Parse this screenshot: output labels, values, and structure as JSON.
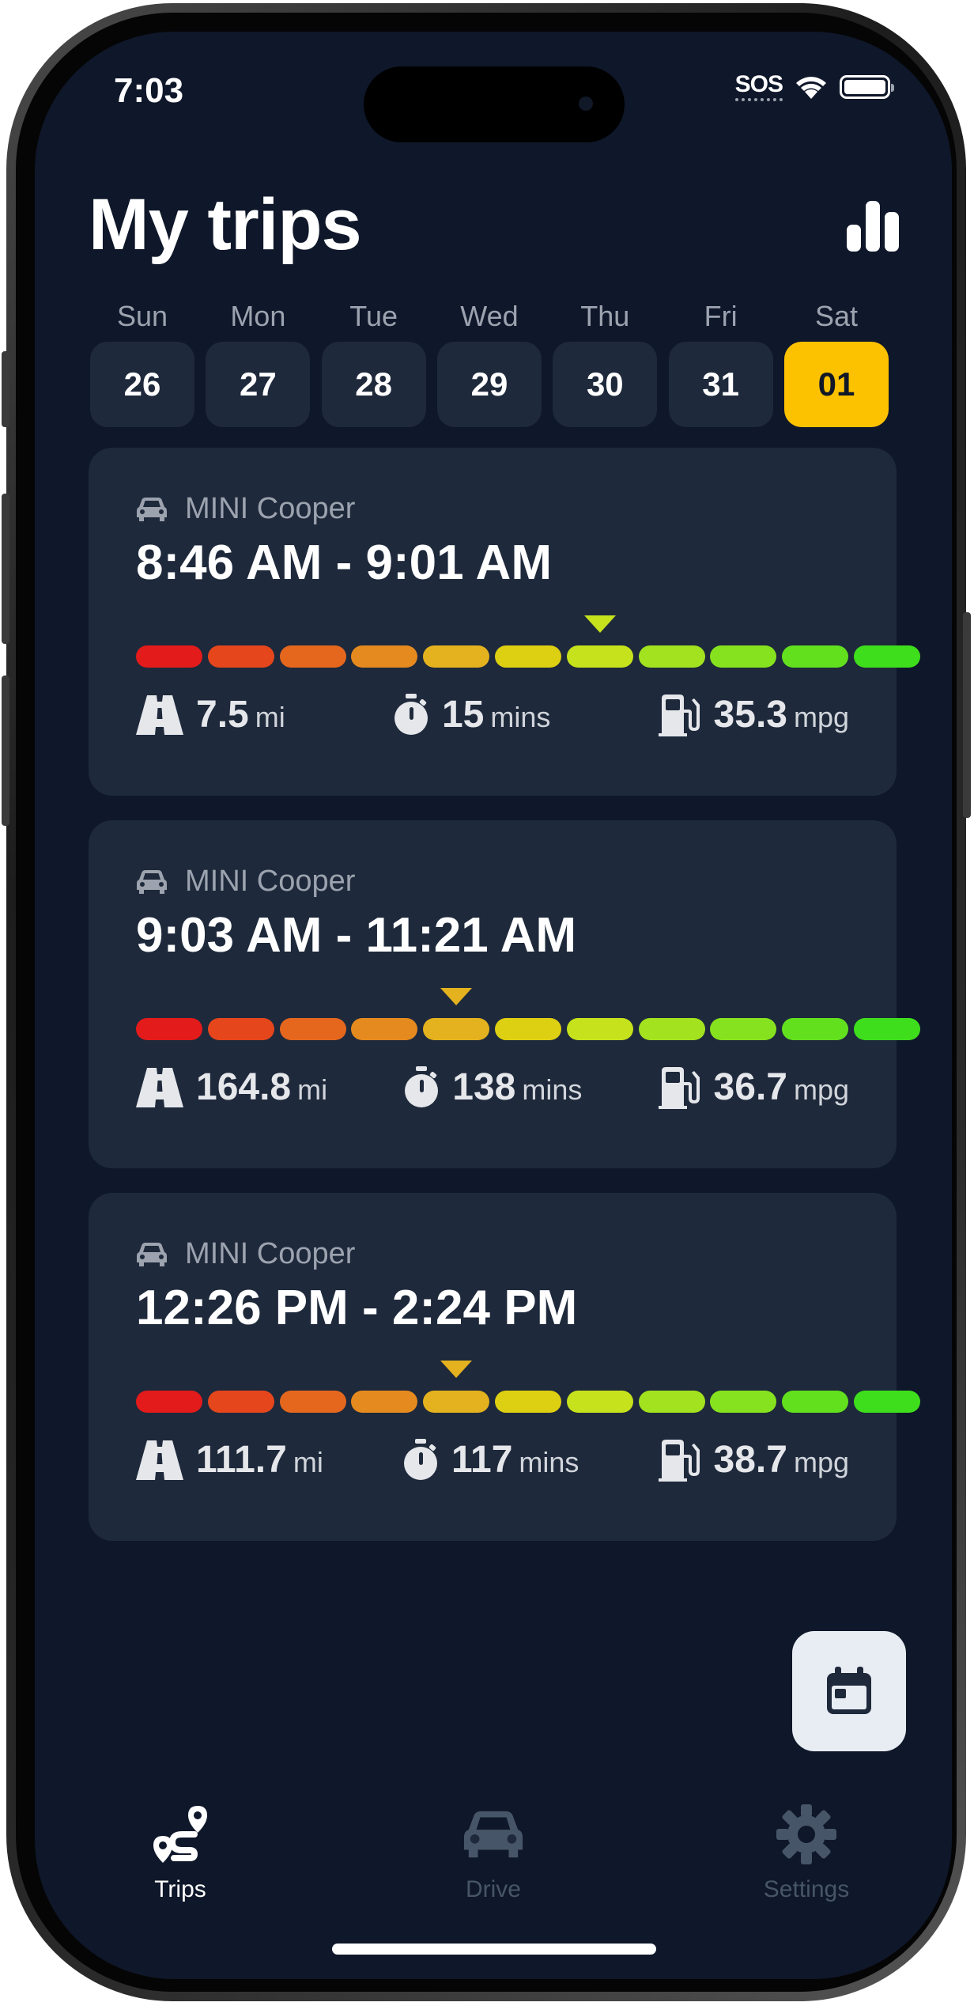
{
  "status_bar": {
    "time": "7:03",
    "carrier": "SOS"
  },
  "header": {
    "title": "My trips",
    "stats_icon": "bar-chart-icon"
  },
  "days": [
    {
      "name": "Sun",
      "date": "26",
      "selected": false
    },
    {
      "name": "Mon",
      "date": "27",
      "selected": false
    },
    {
      "name": "Tue",
      "date": "28",
      "selected": false
    },
    {
      "name": "Wed",
      "date": "29",
      "selected": false
    },
    {
      "name": "Thu",
      "date": "30",
      "selected": false
    },
    {
      "name": "Fri",
      "date": "31",
      "selected": false
    },
    {
      "name": "Sat",
      "date": "01",
      "selected": true
    }
  ],
  "efficiency_scale": {
    "segments": 11,
    "colors": [
      "#e31b1b",
      "#e5461c",
      "#e5671e",
      "#e58a1f",
      "#e3b21e",
      "#ddcf12",
      "#c6e21c",
      "#a2e21f",
      "#86e21e",
      "#62e01e",
      "#3fde1c"
    ]
  },
  "trips": [
    {
      "car": "MINI Cooper",
      "time_range": "8:46 AM - 9:01 AM",
      "efficiency_segment": 7,
      "distance": "7.5",
      "distance_unit": "mi",
      "duration": "15",
      "duration_unit": "mins",
      "economy": "35.3",
      "economy_unit": "mpg"
    },
    {
      "car": "MINI Cooper",
      "time_range": "9:03 AM - 11:21 AM",
      "efficiency_segment": 5,
      "distance": "164.8",
      "distance_unit": "mi",
      "duration": "138",
      "duration_unit": "mins",
      "economy": "36.7",
      "economy_unit": "mpg"
    },
    {
      "car": "MINI Cooper",
      "time_range": "12:26 PM - 2:24 PM",
      "efficiency_segment": 5,
      "distance": "111.7",
      "distance_unit": "mi",
      "duration": "117",
      "duration_unit": "mins",
      "economy": "38.7",
      "economy_unit": "mpg"
    }
  ],
  "fab": {
    "icon": "calendar-icon"
  },
  "tabs": [
    {
      "label": "Trips",
      "icon": "route-icon",
      "active": true
    },
    {
      "label": "Drive",
      "icon": "car-icon",
      "active": false
    },
    {
      "label": "Settings",
      "icon": "gear-icon",
      "active": false
    }
  ],
  "colors": {
    "background": "#0f172a",
    "card": "#1e293b",
    "accent": "#fcc200",
    "inactive_tab": "#475569"
  }
}
